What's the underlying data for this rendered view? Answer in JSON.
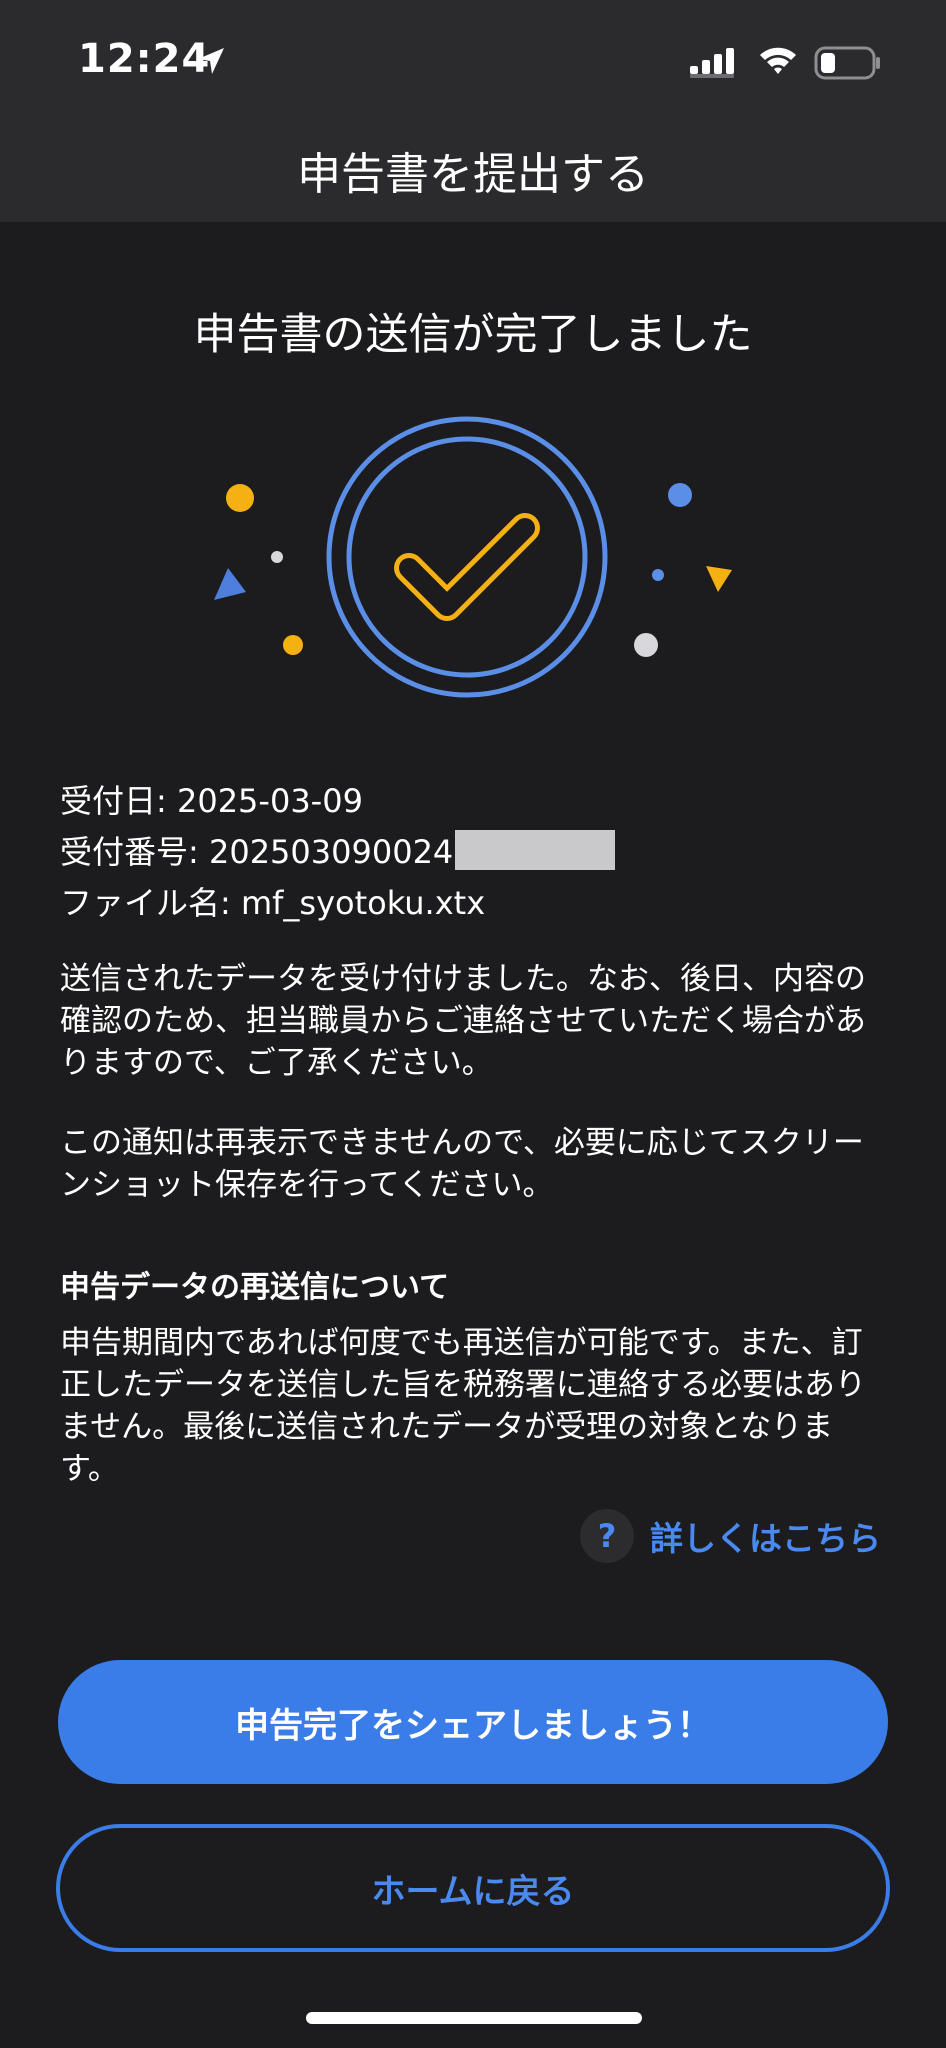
{
  "status": {
    "time": "12:24",
    "icons": [
      "location-arrow-icon",
      "cellular-signal-icon",
      "wifi-icon",
      "battery-icon"
    ]
  },
  "nav": {
    "title": "申告書を提出する"
  },
  "main": {
    "heading": "申告書の送信が完了しました",
    "illustration_icon": "success-check-icon",
    "receipt_date_label": "受付日: ",
    "receipt_date_value": "2025-03-09",
    "receipt_number_label": "受付番号: ",
    "receipt_number_value": "202503090024",
    "file_name_label": "ファイル名: ",
    "file_name_value": "mf_syotoku.xtx",
    "paragraph1": "送信されたデータを受け付けました。なお、後日、内容の確認のため、担当職員からご連絡させていただく場合がありますので、ご了承ください。",
    "paragraph2": "この通知は再表示できませんので、必要に応じてスクリーンショット保存を行ってください。",
    "resend_heading": "申告データの再送信について",
    "paragraph3": "申告期間内であれば何度でも再送信が可能です。また、訂正したデータを送信した旨を税務署に連絡する必要はありません。最後に送信されたデータが受理の対象となります。",
    "help_icon": "?",
    "help_link": "詳しくはこちら"
  },
  "buttons": {
    "share": "申告完了をシェアしましょう！",
    "home": "ホームに戻る"
  },
  "colors": {
    "background": "#1c1c1e",
    "header": "#2b2b2e",
    "accent_blue": "#3a7de8",
    "check_yellow": "#f5b014",
    "ring_blue": "#5b8ee6"
  }
}
